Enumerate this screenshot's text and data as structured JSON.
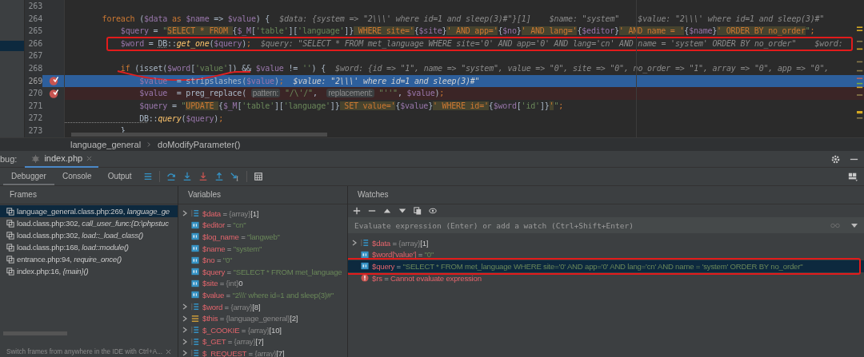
{
  "editor": {
    "lines": [
      {
        "number": "263",
        "kind": "normal",
        "breakpoint": false,
        "marked": false,
        "underlined": false
      },
      {
        "number": "264",
        "kind": "normal",
        "breakpoint": false,
        "marked": false,
        "underlined": false,
        "code": [
          {
            "kind": "kw",
            "text": "        foreach"
          },
          {
            "kind": "plain",
            "text": " ("
          },
          {
            "kind": "var",
            "text": "$data"
          },
          {
            "kind": "kw",
            "text": " as "
          },
          {
            "kind": "var",
            "text": "$name"
          },
          {
            "kind": "plain",
            "text": " => "
          },
          {
            "kind": "var",
            "text": "$value"
          },
          {
            "kind": "plain",
            "text": ") {"
          }
        ],
        "hint": "$data: {system => \"2\\\\\\' where id=1 and sleep(3)#\"}[1]    $name: \"system\"    $value: \"2\\\\\\' where id=1 and sleep(3)#\""
      },
      {
        "number": "265",
        "kind": "normal",
        "breakpoint": false,
        "marked": false,
        "underlined": false,
        "code": [
          {
            "kind": "var",
            "text": "            $query"
          },
          {
            "kind": "plain",
            "text": " = "
          },
          {
            "kind": "str",
            "text": "\""
          },
          {
            "kind": "sql",
            "text": "SELECT * FROM "
          },
          {
            "kind": "plain",
            "text": "{"
          },
          {
            "kind": "var",
            "text": "$_M"
          },
          {
            "kind": "plain",
            "text": "["
          },
          {
            "kind": "str",
            "text": "'table'"
          },
          {
            "kind": "plain",
            "text": "]["
          },
          {
            "kind": "str",
            "text": "'language'"
          },
          {
            "kind": "plain",
            "text": "]}"
          },
          {
            "kind": "sql",
            "text": " WHERE site='"
          },
          {
            "kind": "plain",
            "text": "{"
          },
          {
            "kind": "var",
            "text": "$site"
          },
          {
            "kind": "plain",
            "text": "}"
          },
          {
            "kind": "sql",
            "text": "' AND app='"
          },
          {
            "kind": "plain",
            "text": "{"
          },
          {
            "kind": "var",
            "text": "$no"
          },
          {
            "kind": "plain",
            "text": "}"
          },
          {
            "kind": "sql",
            "text": "' AND lang='"
          },
          {
            "kind": "plain",
            "text": "{"
          },
          {
            "kind": "var",
            "text": "$editor"
          },
          {
            "kind": "plain",
            "text": "}"
          },
          {
            "kind": "sql",
            "text": "' AND name = '"
          },
          {
            "kind": "plain",
            "text": "{"
          },
          {
            "kind": "var",
            "text": "$name"
          },
          {
            "kind": "plain",
            "text": "}"
          },
          {
            "kind": "sql",
            "text": "' ORDER BY no_order"
          },
          {
            "kind": "str",
            "text": "\""
          },
          {
            "kind": "kw",
            "text": ";"
          }
        ]
      },
      {
        "number": "266",
        "kind": "normal",
        "breakpoint": false,
        "marked": true,
        "underlined": false,
        "code": [
          {
            "kind": "var",
            "text": "            $word"
          },
          {
            "kind": "plain",
            "text": " = "
          },
          {
            "kind": "cls",
            "text": "DB"
          },
          {
            "kind": "plain",
            "text": "::"
          },
          {
            "kind": "func",
            "text": "get_one"
          },
          {
            "kind": "plain",
            "text": "("
          },
          {
            "kind": "var",
            "text": "$query"
          },
          {
            "kind": "plain",
            "text": ")"
          },
          {
            "kind": "kw",
            "text": ";"
          }
        ],
        "hint": "$query: \"SELECT * FROM met_language WHERE site='0' AND app='0' AND lang='cn' AND name = 'system' ORDER BY no_order\"    $word:"
      },
      {
        "number": "267",
        "kind": "normal",
        "breakpoint": false,
        "marked": false,
        "underlined": false
      },
      {
        "number": "268",
        "kind": "normal",
        "breakpoint": false,
        "marked": false,
        "underlined": true,
        "code": [
          {
            "kind": "kw",
            "text": "            if"
          },
          {
            "kind": "plain",
            "text": " (isset("
          },
          {
            "kind": "var",
            "text": "$word"
          },
          {
            "kind": "plain",
            "text": "["
          },
          {
            "kind": "str",
            "text": "'value'"
          },
          {
            "kind": "plain",
            "text": "]) && "
          },
          {
            "kind": "var",
            "text": "$value"
          },
          {
            "kind": "plain",
            "text": " != "
          },
          {
            "kind": "str",
            "text": "''"
          },
          {
            "kind": "plain",
            "text": ") {"
          }
        ],
        "hint": "$word: {id => \"1\", name => \"system\", value => \"0\", site => \"0\", no_order => \"1\", array => \"0\", app => \"0\","
      },
      {
        "number": "269",
        "kind": "current",
        "breakpoint": true,
        "marked": false,
        "underlined": false,
        "code": [
          {
            "kind": "var",
            "text": "                $value"
          },
          {
            "kind": "plain",
            "text": "  = stripslashes("
          },
          {
            "kind": "var",
            "text": "$value"
          },
          {
            "kind": "plain",
            "text": ")"
          },
          {
            "kind": "kw",
            "text": ";"
          }
        ],
        "hint": "$value: \"2\\\\\\' where id=1 and sleep(3)#\""
      },
      {
        "number": "270",
        "kind": "breakpoint",
        "breakpoint": true,
        "marked": false,
        "underlined": false,
        "code": [
          {
            "kind": "var",
            "text": "                $value"
          },
          {
            "kind": "plain",
            "text": "  = preg_replace( "
          },
          {
            "kind": "param",
            "text": "pattern:"
          },
          {
            "kind": "str",
            "text": " \"/\\'/\""
          },
          {
            "kind": "plain",
            "text": ",  "
          },
          {
            "kind": "param",
            "text": "replacement:"
          },
          {
            "kind": "str",
            "text": " \"''\""
          },
          {
            "kind": "plain",
            "text": ", "
          },
          {
            "kind": "var",
            "text": "$value"
          },
          {
            "kind": "plain",
            "text": ")"
          },
          {
            "kind": "kw",
            "text": ";"
          }
        ]
      },
      {
        "number": "271",
        "kind": "normal",
        "breakpoint": false,
        "marked": false,
        "underlined": false,
        "code": [
          {
            "kind": "var",
            "text": "                $query"
          },
          {
            "kind": "plain",
            "text": " = "
          },
          {
            "kind": "str",
            "text": "\""
          },
          {
            "kind": "sql",
            "text": "UPDATE "
          },
          {
            "kind": "plain",
            "text": "{"
          },
          {
            "kind": "var",
            "text": "$_M"
          },
          {
            "kind": "plain",
            "text": "["
          },
          {
            "kind": "str",
            "text": "'table'"
          },
          {
            "kind": "plain",
            "text": "]["
          },
          {
            "kind": "str",
            "text": "'language'"
          },
          {
            "kind": "plain",
            "text": "]}"
          },
          {
            "kind": "sql",
            "text": " SET value='"
          },
          {
            "kind": "plain",
            "text": "{"
          },
          {
            "kind": "var",
            "text": "$value"
          },
          {
            "kind": "plain",
            "text": "}"
          },
          {
            "kind": "sql",
            "text": "' WHERE id='"
          },
          {
            "kind": "plain",
            "text": "{"
          },
          {
            "kind": "var",
            "text": "$word"
          },
          {
            "kind": "plain",
            "text": "["
          },
          {
            "kind": "str",
            "text": "'id'"
          },
          {
            "kind": "plain",
            "text": "]}"
          },
          {
            "kind": "sql",
            "text": "'"
          },
          {
            "kind": "str",
            "text": "\""
          },
          {
            "kind": "kw",
            "text": ";"
          }
        ]
      },
      {
        "number": "272",
        "kind": "normal",
        "breakpoint": false,
        "marked": false,
        "underlined": false,
        "code": [
          {
            "kind": "cls",
            "text": "                DB"
          },
          {
            "kind": "plain",
            "text": "::"
          },
          {
            "kind": "func",
            "text": "query"
          },
          {
            "kind": "plain",
            "text": "("
          },
          {
            "kind": "var",
            "text": "$query"
          },
          {
            "kind": "plain",
            "text": ")"
          },
          {
            "kind": "kw",
            "text": ";"
          }
        ]
      },
      {
        "number": "273",
        "kind": "normal",
        "breakpoint": false,
        "marked": false,
        "underlined": false,
        "code": [
          {
            "kind": "plain",
            "text": "            }"
          }
        ]
      }
    ]
  },
  "breadcrumb": [
    "language_general",
    "doModifyParameter()"
  ],
  "debug": {
    "prefix": "bug:",
    "session_tab": "index.php",
    "tabs": [
      {
        "label": "Debugger",
        "selected": true
      },
      {
        "label": "Console",
        "selected": false
      },
      {
        "label": "Output",
        "selected": false
      }
    ],
    "frames": {
      "title": "Frames",
      "items": [
        {
          "location": "language_general.class.php:269, ",
          "call": "language_ge",
          "selected": true
        },
        {
          "location": "load.class.php:302, ",
          "call": "call_user_func:{D:\\phpstuc",
          "selected": false
        },
        {
          "location": "load.class.php:302, ",
          "call": "load::_load_class()",
          "selected": false
        },
        {
          "location": "load.class.php:168, ",
          "call": "load::module()",
          "selected": false
        },
        {
          "location": "entrance.php:94, ",
          "call": "require_once()",
          "selected": false
        },
        {
          "location": "index.php:16, ",
          "call": "{main}()",
          "selected": false
        }
      ],
      "hint": "Switch frames from anywhere in the IDE with Ctrl+A..."
    },
    "variables": {
      "title": "Variables",
      "items": [
        {
          "kind": "array",
          "expandable": true,
          "name": "$data",
          "op": "=",
          "type": "{array}",
          "value": "[1]"
        },
        {
          "kind": "scalar",
          "expandable": false,
          "name": "$editor",
          "op": "=",
          "value": "\"cn\""
        },
        {
          "kind": "scalar",
          "expandable": false,
          "name": "$log_name",
          "op": "=",
          "value": "\"langweb\""
        },
        {
          "kind": "scalar",
          "expandable": false,
          "name": "$name",
          "op": "=",
          "value": "\"system\""
        },
        {
          "kind": "scalar",
          "expandable": false,
          "name": "$no",
          "op": "=",
          "value": "\"0\""
        },
        {
          "kind": "scalar",
          "expandable": false,
          "name": "$query",
          "op": "=",
          "value": "\"SELECT * FROM met_language"
        },
        {
          "kind": "scalar",
          "expandable": false,
          "name": "$site",
          "op": "=",
          "type": "{int}",
          "value": "0"
        },
        {
          "kind": "scalar",
          "expandable": false,
          "name": "$value",
          "op": "=",
          "value": "\"2\\\\\\' where id=1 and sleep(3)#\""
        },
        {
          "kind": "array",
          "expandable": true,
          "name": "$word",
          "op": "=",
          "type": "{array}",
          "value": "[8]"
        },
        {
          "kind": "object",
          "expandable": true,
          "name": "$this",
          "op": "=",
          "type": "{language_general}",
          "value": "[2]"
        },
        {
          "kind": "array",
          "expandable": true,
          "name": "$_COOKIE",
          "op": "=",
          "type": "{array}",
          "value": "[10]"
        },
        {
          "kind": "array",
          "expandable": true,
          "name": "$_GET",
          "op": "=",
          "type": "{array}",
          "value": "[7]"
        },
        {
          "kind": "array",
          "expandable": true,
          "name": "$_REQUEST",
          "op": "=",
          "type": "{array}",
          "value": "[7]"
        }
      ]
    },
    "watches": {
      "title": "Watches",
      "placeholder": "Evaluate expression (Enter) or add a watch (Ctrl+Shift+Enter)",
      "items": [
        {
          "kind": "array",
          "expandable": true,
          "name": "$data",
          "op": "=",
          "type": "{array}",
          "value": "[1]",
          "selected": false,
          "marked": false
        },
        {
          "kind": "scalar",
          "expandable": false,
          "name": "$word['value']",
          "op": "=",
          "value": "\"0\"",
          "selected": false,
          "marked": false
        },
        {
          "kind": "scalar",
          "expandable": false,
          "name": "$query",
          "op": "=",
          "value": "\"SELECT * FROM met_language WHERE site='0' AND app='0' AND lang='cn' AND name = 'system' ORDER BY no_order\"",
          "selected": true,
          "marked": true
        },
        {
          "kind": "error",
          "expandable": false,
          "name": "$rs",
          "op": "=",
          "value": "Cannot evaluate expression",
          "selected": false,
          "marked": false
        }
      ]
    }
  }
}
